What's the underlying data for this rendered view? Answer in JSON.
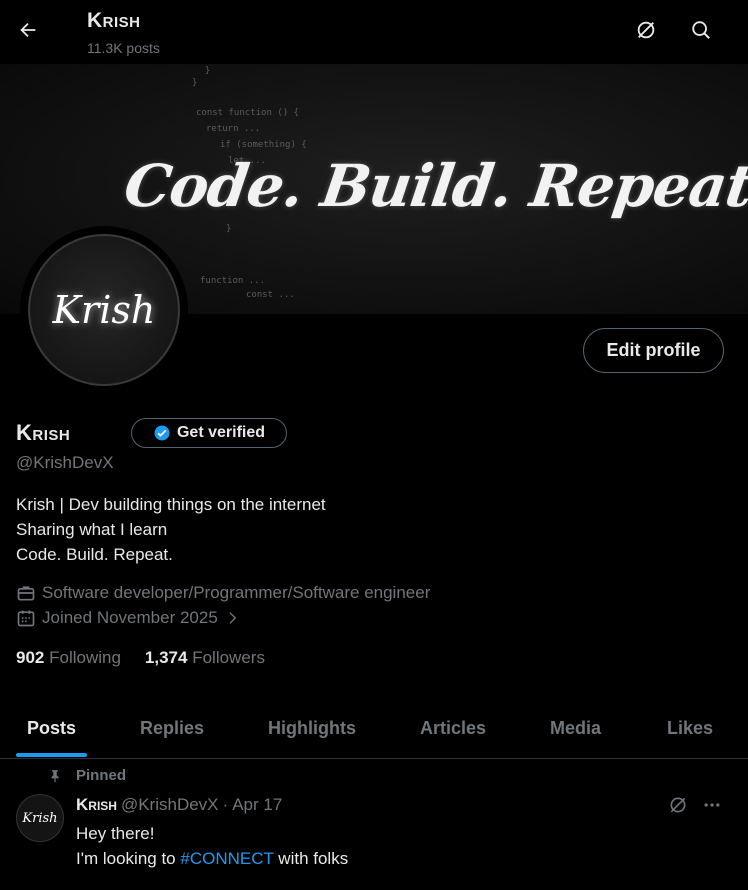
{
  "header": {
    "name": "Krish",
    "posts_count": "11.3K posts"
  },
  "banner": {
    "tagline": "Code. Build. Repeat.",
    "code_lines": [
      "}",
      "}",
      "const function () {",
      "return ...",
      "if (something) {",
      "let ...",
      "}",
      "function ...",
      "const ..."
    ]
  },
  "avatar": {
    "text": "Krish"
  },
  "actions": {
    "edit_profile": "Edit profile",
    "get_verified": "Get verified"
  },
  "profile": {
    "name": "Krish",
    "handle": "@KrishDevX",
    "bio": [
      "Krish | Dev building things on the internet",
      "Sharing what I learn",
      "Code. Build. Repeat."
    ],
    "profession": "Software developer/Programmer/Software engineer",
    "joined": "Joined November 2025",
    "following_count": "902",
    "following_label": "Following",
    "followers_count": "1,374",
    "followers_label": "Followers"
  },
  "tabs": [
    "Posts",
    "Replies",
    "Highlights",
    "Articles",
    "Media",
    "Likes"
  ],
  "post": {
    "pinned_label": "Pinned",
    "avatar_text": "Krish",
    "name": "Krish",
    "handle": "@KrishDevX",
    "separator": "·",
    "date": "Apr 17",
    "line1": "Hey there!",
    "line2_prefix": "I'm looking to ",
    "hashtag": "#CONNECT",
    "line2_suffix": " with folks"
  },
  "colors": {
    "accent": "#1d9bf0",
    "muted": "#71767b",
    "text": "#e7e9ea",
    "border": "#536471"
  },
  "icons": [
    "back-arrow-icon",
    "grok-icon",
    "search-icon",
    "verified-badge-icon",
    "briefcase-icon",
    "calendar-icon",
    "chevron-right-icon",
    "pin-icon",
    "more-icon"
  ]
}
